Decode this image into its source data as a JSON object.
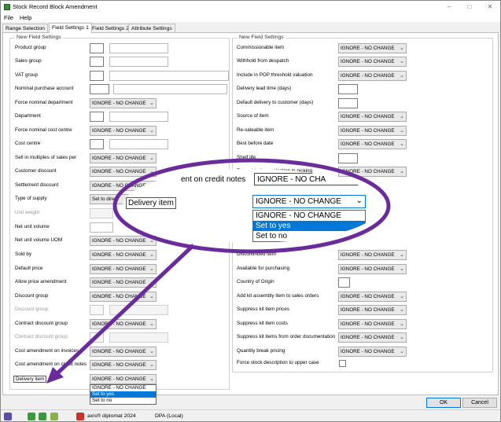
{
  "window": {
    "title": "Stock Record Block Amendment",
    "controls": {
      "minimize": "–",
      "maximize": "□",
      "close": "✕"
    }
  },
  "menu": {
    "file": "File",
    "help": "Help"
  },
  "tabs": [
    {
      "label": "Range Selection"
    },
    {
      "label": "Field Settings 1"
    },
    {
      "label": "Field Settings 2"
    },
    {
      "label": "Attribute Settings"
    }
  ],
  "left_group": {
    "legend": "New Field Settings",
    "rows": [
      {
        "label": "Product group"
      },
      {
        "label": "Sales group"
      },
      {
        "label": "VAT group"
      },
      {
        "label": "Nominal purchase account"
      },
      {
        "label": "Force nominal department",
        "value": "IGNORE - NO CHANGE"
      },
      {
        "label": "Department"
      },
      {
        "label": "Force nominal cost centre",
        "value": "IGNORE - NO CHANGE"
      },
      {
        "label": "Cost centre"
      },
      {
        "label": "Sell in multiples of sales per",
        "value": "IGNORE - NO CHANGE"
      },
      {
        "label": "Customer discount",
        "value": "IGNORE - NO CHANGE"
      },
      {
        "label": "Settlement discount",
        "value": "IGNORE - NO CHANGE"
      },
      {
        "label": "Type of supply",
        "value": "Set to direct"
      },
      {
        "label": "Unit weight"
      },
      {
        "label": "Net unit volume"
      },
      {
        "label": "Net unit volume UOM",
        "value": "IGNORE - NO CHANGE"
      },
      {
        "label": "Sold by",
        "value": "IGNORE - NO CHANGE"
      },
      {
        "label": "Default price",
        "value": "IGNORE - NO CHANGE"
      },
      {
        "label": "Allow price amendment",
        "value": "IGNORE - NO CHANGE"
      },
      {
        "label": "Discount group",
        "value": "IGNORE - NO CHANGE"
      },
      {
        "label": "Discount group"
      },
      {
        "label": "Contract discount group",
        "value": "IGNORE - NO CHANGE"
      },
      {
        "label": "Contract discount group"
      },
      {
        "label": "Cost amendment on invoices",
        "value": "IGNORE - NO CHANGE"
      },
      {
        "label": "Cost amendment on credit notes",
        "value": "IGNORE - NO CHANGE"
      },
      {
        "label": "Delivery item",
        "value": "IGNORE - NO CHANGE"
      }
    ],
    "delivery_options": [
      "IGNORE - NO CHANGE",
      "Set to yes",
      "Set to no"
    ]
  },
  "right_group": {
    "legend": "New Field Settings",
    "rows": [
      {
        "label": "Commissionable item",
        "value": "IGNORE - NO CHANGE"
      },
      {
        "label": "Withhold from despatch",
        "value": "IGNORE - NO CHANGE"
      },
      {
        "label": "Include in POP threshold valuation",
        "value": "IGNORE - NO CHANGE"
      },
      {
        "label": "Delivery lead time (days)"
      },
      {
        "label": "Default delivery to customer (days)"
      },
      {
        "label": "Source of item",
        "value": "IGNORE - NO CHANGE"
      },
      {
        "label": "Re-saleable item",
        "value": "IGNORE - NO CHANGE"
      },
      {
        "label": "Best before date",
        "value": "IGNORE - NO CHANGE"
      },
      {
        "label": "Shelf life"
      },
      {
        "label": "Traceable item selection in picking",
        "value": "IGNORE - NO CHANGE"
      },
      {
        "label": "Discontinued item",
        "value": "IGNORE - NO CHANGE"
      },
      {
        "label": "Available for purchasing",
        "value": "IGNORE - NO CHANGE"
      },
      {
        "label": "Country of Origin"
      },
      {
        "label": "Add kit assembly item to sales orders",
        "value": "IGNORE - NO CHANGE"
      },
      {
        "label": "Suppress kit item prices",
        "value": "IGNORE - NO CHANGE"
      },
      {
        "label": "Suppress kit item costs",
        "value": "IGNORE - NO CHANGE"
      },
      {
        "label": "Suppress kit items from order documentation",
        "value": "IGNORE - NO CHANGE"
      },
      {
        "label": "Quantity break pricing",
        "value": "IGNORE - NO CHANGE"
      },
      {
        "label": "Force stock description to upper case"
      }
    ],
    "partial_label": "ent on credit notes",
    "partial_value": "IGNORE - NO CHA"
  },
  "zoom": {
    "label": "Delivery item",
    "value": "IGNORE - NO CHANGE",
    "options": [
      "IGNORE - NO CHANGE",
      "Set to yes",
      "Set to no"
    ]
  },
  "buttons": {
    "ok": "OK",
    "cancel": "Cancel"
  },
  "status": {
    "product": "axis® diplomat 2024",
    "company": "DPA (Local)"
  },
  "colors": {
    "accent": "#0078d7",
    "callout": "#6a2c9a"
  }
}
